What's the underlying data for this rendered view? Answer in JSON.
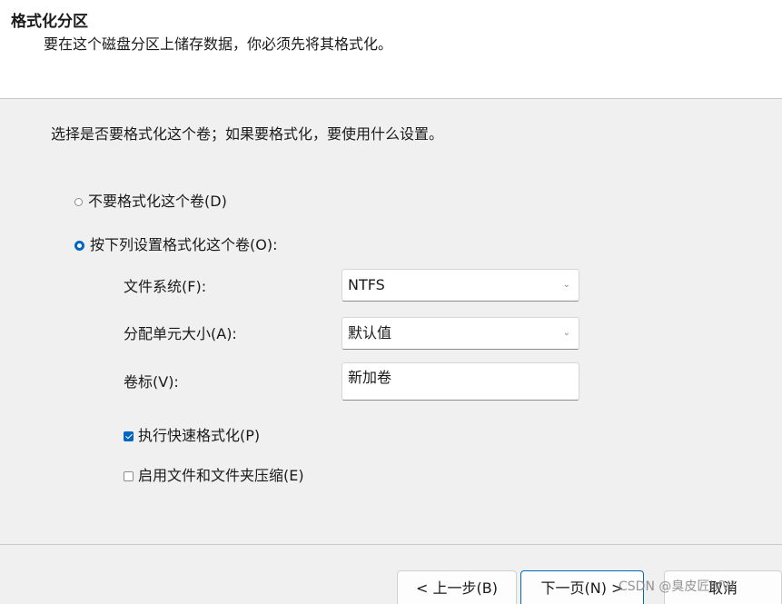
{
  "header": {
    "title": "格式化分区",
    "subtitle": "要在这个磁盘分区上储存数据，你必须先将其格式化。"
  },
  "body": {
    "instruction": "选择是否要格式化这个卷；如果要格式化，要使用什么设置。",
    "options": {
      "no_format": {
        "label": "不要格式化这个卷(D)",
        "selected": false
      },
      "format": {
        "label": "按下列设置格式化这个卷(O):",
        "selected": true
      }
    },
    "fields": {
      "file_system": {
        "label": "文件系统(F):",
        "value": "NTFS"
      },
      "allocation_size": {
        "label": "分配单元大小(A):",
        "value": "默认值"
      },
      "volume_label": {
        "label": "卷标(V):",
        "value": "新加卷"
      }
    },
    "checkboxes": {
      "quick_format": {
        "label": "执行快速格式化(P)",
        "checked": true
      },
      "compression": {
        "label": "启用文件和文件夹压缩(E)",
        "checked": false
      }
    }
  },
  "footer": {
    "back_label": "< 上一步(B)",
    "next_label": "下一页(N) >",
    "cancel_label": "取消"
  },
  "watermark": "CSDN @臭皮匠hfW",
  "icons": {
    "dropdown": "chevron-down-icon"
  },
  "colors": {
    "accent": "#0067c0",
    "panel_bg": "#f0f0f0"
  }
}
